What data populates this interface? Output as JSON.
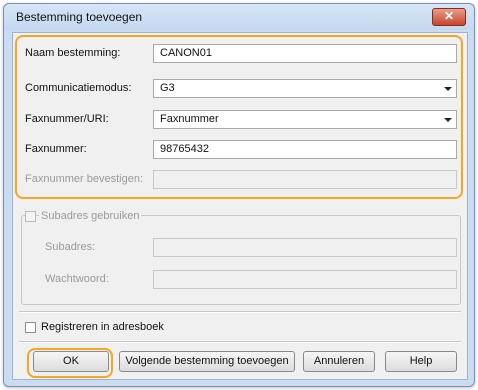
{
  "window": {
    "title": "Bestemming toevoegen",
    "close_glyph": "✕"
  },
  "form": {
    "name_label": "Naam bestemming:",
    "name_value": "CANON01",
    "mode_label": "Communicatiemodus:",
    "mode_value": "G3",
    "fax_uri_label": "Faxnummer/URI:",
    "fax_uri_value": "Faxnummer",
    "fax_label": "Faxnummer:",
    "fax_value": "98765432",
    "confirm_label": "Faxnummer bevestigen:",
    "confirm_value": ""
  },
  "subaddress": {
    "checkbox_label": "Subadres gebruiken",
    "subaddress_label": "Subadres:",
    "password_label": "Wachtwoord:"
  },
  "register_label": "Registreren in adresboek",
  "buttons": {
    "ok": "OK",
    "next": "Volgende bestemming toevoegen",
    "cancel": "Annuleren",
    "help": "Help"
  },
  "colors": {
    "highlight": "#f5a623",
    "titlebar": "#c9dcf2"
  }
}
